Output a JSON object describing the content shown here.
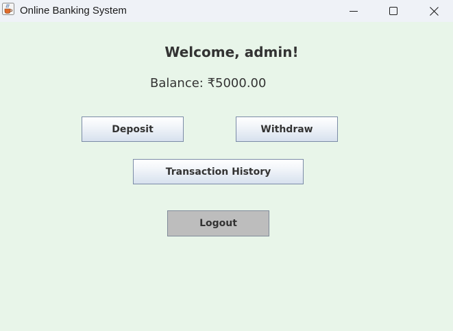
{
  "window": {
    "title": "Online Banking System",
    "icon": "java-cup-icon",
    "controls": {
      "minimize": "minimize-icon",
      "maximize": "maximize-icon",
      "close": "close-icon"
    }
  },
  "dashboard": {
    "welcome": "Welcome, admin!",
    "balance": "Balance: ₹5000.00",
    "buttons": {
      "deposit": "Deposit",
      "withdraw": "Withdraw",
      "history": "Transaction History",
      "logout": "Logout"
    }
  },
  "colors": {
    "background": "#e8f5e9",
    "titlebar": "#eff2f7",
    "text": "#333333",
    "logout_button": "#bdbdbd"
  }
}
